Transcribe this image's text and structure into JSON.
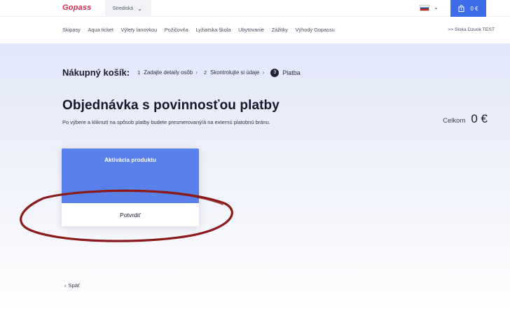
{
  "topbar": {
    "logo": "Gopass",
    "region": "Strediská",
    "language_flag": "slovak-flag",
    "cart_total": "0 €"
  },
  "nav": {
    "items": [
      "Skipasy",
      "Aqua ticket",
      "Výlety lanovkou",
      "Požičovňa",
      "Lyžiarska škola",
      "Ubytovanie",
      "Zážitky",
      "Výhody Gopassu"
    ],
    "user": ">> Siska Dzurik TEST"
  },
  "checkout": {
    "title": "Nákupný košík:",
    "steps": [
      {
        "num": "1",
        "label": "Zadajte detaily osôb"
      },
      {
        "num": "2",
        "label": "Skontrolujte si údaje"
      },
      {
        "num": "3",
        "label": "Platba"
      }
    ]
  },
  "main": {
    "title": "Objednávka s povinnosťou platby",
    "description": "Po výbere a kliknutí na spôsob platby budete presmerovaný/á na externú platobnú bránu.",
    "total_label": "Celkom",
    "total_value": "0 €"
  },
  "payment_card": {
    "title": "Aktivácia produktu",
    "button": "Potvrdiť"
  },
  "back": {
    "label": "Späť"
  },
  "colors": {
    "accent": "#3d6ce8",
    "card_header": "#5a80ec",
    "annotation": "#8b1a1a",
    "logo": "#d12d4f"
  }
}
